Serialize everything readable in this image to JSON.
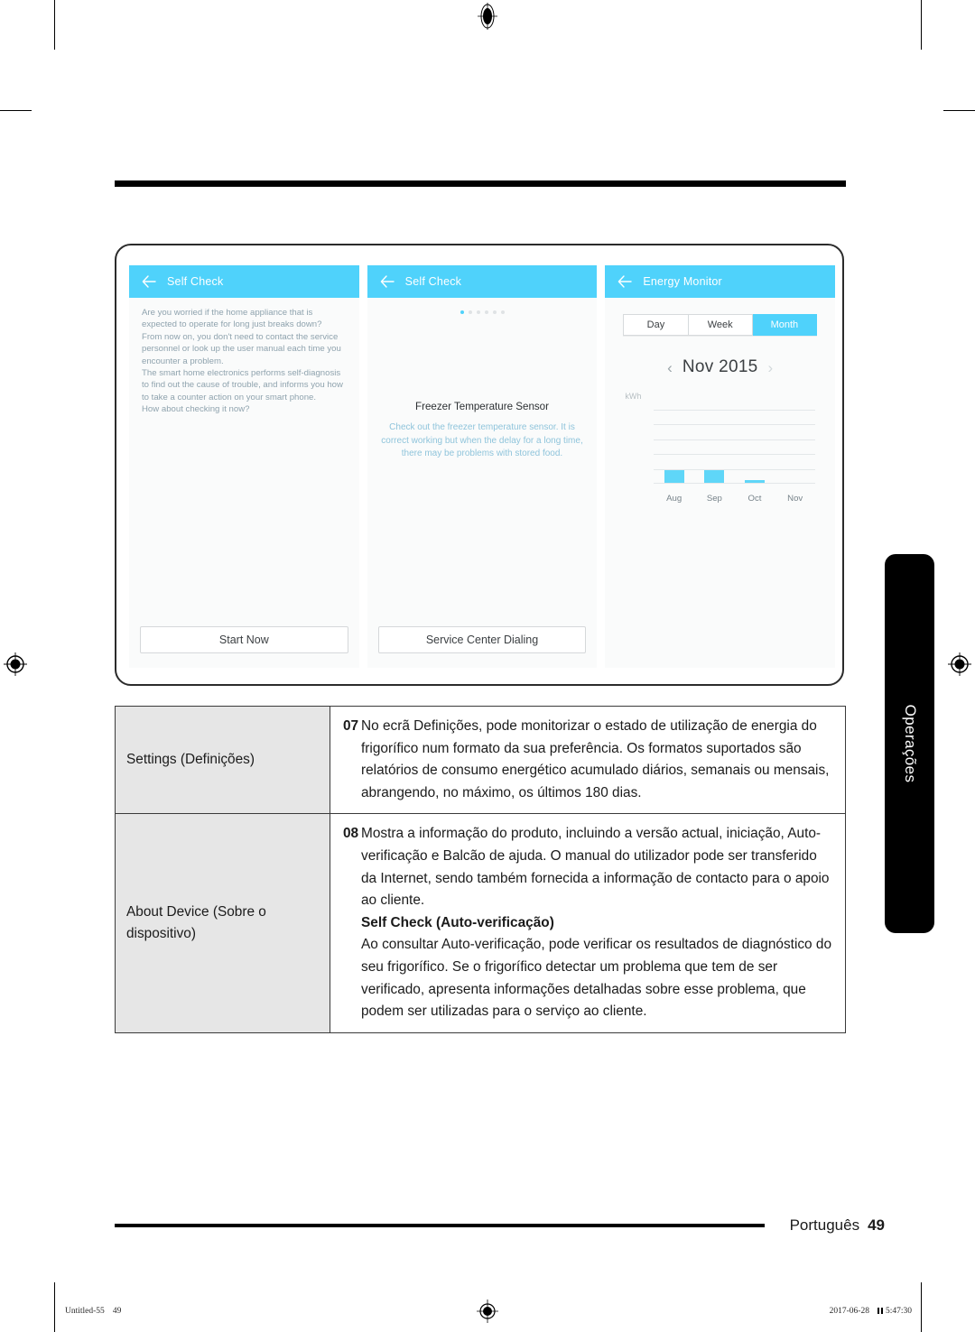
{
  "page": {
    "top_rule": true,
    "language": "Português",
    "page_number": "49",
    "side_tab_label": "Operações"
  },
  "slug": {
    "left_doc": "Untitled-55",
    "left_page": "49",
    "right_date": "2017-06-28",
    "right_time": "5:47:30"
  },
  "screenshots": {
    "self_check_intro": {
      "appbar_title": "Self Check",
      "back_icon": "back-arrow-icon",
      "paragraphs": [
        "Are you worried if the home appliance that is expected to operate for long just breaks down?",
        "From now on, you don't need to contact the service personnel or look up the user manual each time you encounter a problem.",
        "The smart home electronics performs self-diagnosis to find out the cause of trouble, and informs you how to take a counter action on your smart phone.",
        "How about checking it now?"
      ],
      "button_label": "Start Now"
    },
    "self_check_result": {
      "appbar_title": "Self Check",
      "back_icon": "back-arrow-icon",
      "pager": {
        "total": 6,
        "active_index": 0
      },
      "sensor_title": "Freezer Temperature Sensor",
      "sensor_desc": "Check out the freezer temperature sensor. It is correct working but when the delay for a long time, there may be problems with stored food.",
      "button_label": "Service Center Dialing"
    },
    "energy_monitor": {
      "appbar_title": "Energy Monitor",
      "back_icon": "back-arrow-icon",
      "segments": [
        "Day",
        "Week",
        "Month"
      ],
      "selected_segment": "Month",
      "prev_icon": "chevron-left-icon",
      "next_icon": "chevron-right-icon",
      "period_label": "Nov 2015",
      "accent_color": "#4fd2fb"
    }
  },
  "chart_data": {
    "type": "bar",
    "title": "",
    "xlabel": "",
    "ylabel": "kWh",
    "categories": [
      "Aug",
      "Sep",
      "Oct",
      "Nov"
    ],
    "values": [
      17,
      17,
      4,
      0
    ],
    "ylim": [
      0,
      100
    ],
    "gridlines": [
      20,
      40,
      60,
      80,
      100
    ],
    "grid": true,
    "legend": "none",
    "bar_color": "#5fd6f8"
  },
  "table": {
    "rows": [
      {
        "key": "Settings (Definições)",
        "items": [
          {
            "num": "07",
            "text": "No ecrã Definições, pode monitorizar o estado de utilização de energia do frigorífico num formato da sua preferência. Os formatos suportados são relatórios de consumo energético acumulado diários, semanais ou mensais, abrangendo, no máximo, os últimos 180 dias."
          }
        ]
      },
      {
        "key": "About Device (Sobre o dispositivo)",
        "items": [
          {
            "num": "08",
            "text": "Mostra a informação do produto, incluindo a versão actual, iniciação, Auto-verificação e Balcão de ajuda. O manual do utilizador pode ser transferido da Internet, sendo também fornecida a informação de contacto para o apoio ao cliente."
          }
        ],
        "subhead": "Self Check (Auto-verificação)",
        "subtext": "Ao consultar Auto-verificação, pode verificar os resultados de diagnóstico do seu frigorífico. Se o frigorífico detectar um problema que tem de ser verificado, apresenta informações detalhadas sobre esse problema, que podem ser utilizadas para o serviço ao cliente."
      }
    ]
  }
}
